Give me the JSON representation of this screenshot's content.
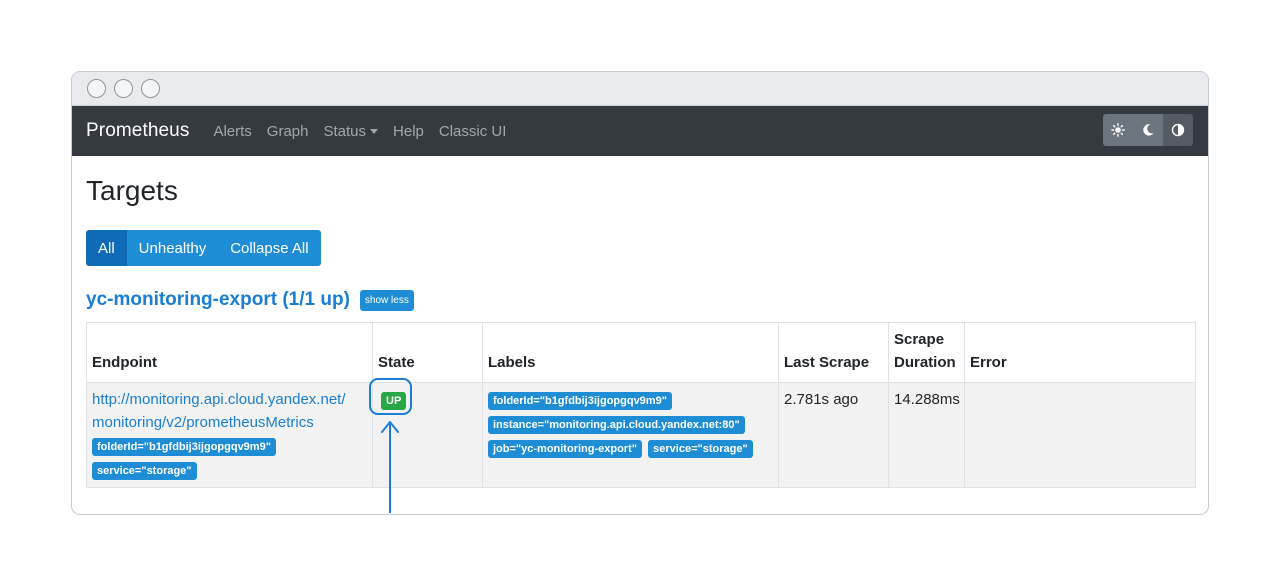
{
  "navbar": {
    "brand": "Prometheus",
    "links": [
      "Alerts",
      "Graph",
      "Status",
      "Help",
      "Classic UI"
    ],
    "theme_icons": [
      "sun-icon",
      "moon-icon",
      "half-circle-icon"
    ]
  },
  "page": {
    "title": "Targets",
    "filters": [
      "All",
      "Unhealthy",
      "Collapse All"
    ],
    "active_filter": "All"
  },
  "job": {
    "title": "yc-monitoring-export (1/1 up)",
    "toggle_label": "show less"
  },
  "table": {
    "headers": {
      "endpoint": "Endpoint",
      "state": "State",
      "labels": "Labels",
      "last_scrape": "Last Scrape",
      "scrape_duration_line1": "Scrape",
      "scrape_duration_line2": "Duration",
      "error": "Error"
    },
    "rows": [
      {
        "endpoint_line1": "http://monitoring.api.cloud.yandex.net/",
        "endpoint_line2": "monitoring/v2/prometheusMetrics",
        "endpoint_params": [
          "folderId=\"b1gfdbij3ijgopgqv9m9\"",
          "service=\"storage\""
        ],
        "state": "UP",
        "labels": [
          "folderId=\"b1gfdbij3ijgopgqv9m9\"",
          "instance=\"monitoring.api.cloud.yandex.net:80\"",
          "job=\"yc-monitoring-export\"",
          "service=\"storage\""
        ],
        "last_scrape": "2.781s ago",
        "scrape_duration": "14.288ms",
        "error": ""
      }
    ]
  },
  "colors": {
    "navbar_bg": "#343a40",
    "primary": "#1f8dd6",
    "primary_active": "#0f6bb5",
    "up_green": "#28a745",
    "link": "#1a7fd3",
    "annotation": "#1a7fd3"
  }
}
